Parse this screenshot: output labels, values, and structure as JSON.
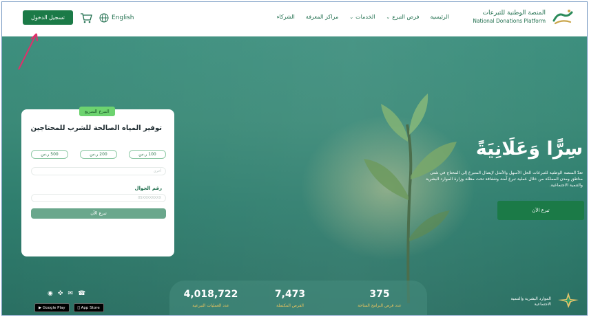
{
  "header": {
    "logo": {
      "ar": "المنصة الوطنية للتبرعات",
      "en": "National Donations Platform",
      "mark_text": "تبرع"
    },
    "nav": [
      {
        "label": "الرئيسية",
        "has_chevron": false
      },
      {
        "label": "فرص التبرع",
        "has_chevron": true
      },
      {
        "label": "الخدمات",
        "has_chevron": true
      },
      {
        "label": "مراكز المعرفة",
        "has_chevron": false
      },
      {
        "label": "الشركاء",
        "has_chevron": false
      }
    ],
    "login_label": "تسجيل الدخول",
    "language_label": "English",
    "icons": [
      "cart-icon",
      "globe-icon"
    ]
  },
  "card": {
    "tag": "التبرع السريع",
    "title": "توفير المياه الصالحة للشرب للمحتاجين",
    "amounts": [
      {
        "value": "100",
        "unit": "ر.س"
      },
      {
        "value": "200",
        "unit": "ر.س"
      },
      {
        "value": "500",
        "unit": "ر.س"
      }
    ],
    "amount_placeholder": "أخرى",
    "phone_label": "رقم الجوال",
    "phone_placeholder": "05XXXXXXXX",
    "donate_label": "تبرع الآن"
  },
  "hero": {
    "headline": "سِرًّا وَعَلَانِيَةً",
    "description": "تعدّ المنصة الوطنية للتبرعات الحل الأسهل والأمثل لإيصال المتبرع إلى المحتاج في شتى مناطق ومدن المملكة من خلال عملية تبرع آمنة وشفافة تحت مظلة وزارة الموارد البشرية والتنمية الاجتماعية.",
    "donate_label": "تبرع الآن"
  },
  "stats": [
    {
      "value": "375",
      "label": "عدد فرص البرامج المتاحة"
    },
    {
      "value": "7,473",
      "label": "الفرص المكتملة"
    },
    {
      "value": "4,018,722",
      "label": "عدد العمليات التبرعية"
    }
  ],
  "footer": {
    "social_icons": [
      "whatsapp-icon",
      "email-icon",
      "twitter-icon",
      "instagram-icon"
    ],
    "stores": [
      {
        "label": "App Store",
        "icon": "apple-icon"
      },
      {
        "label": "Google Play",
        "icon": "play-icon"
      }
    ],
    "ministry": "الموارد البشرية والتنمية الاجتماعية"
  },
  "colors": {
    "primary": "#1b7a47",
    "accent": "#f0c65d",
    "tag": "#6dd36f",
    "annotation": "#e0306a"
  }
}
